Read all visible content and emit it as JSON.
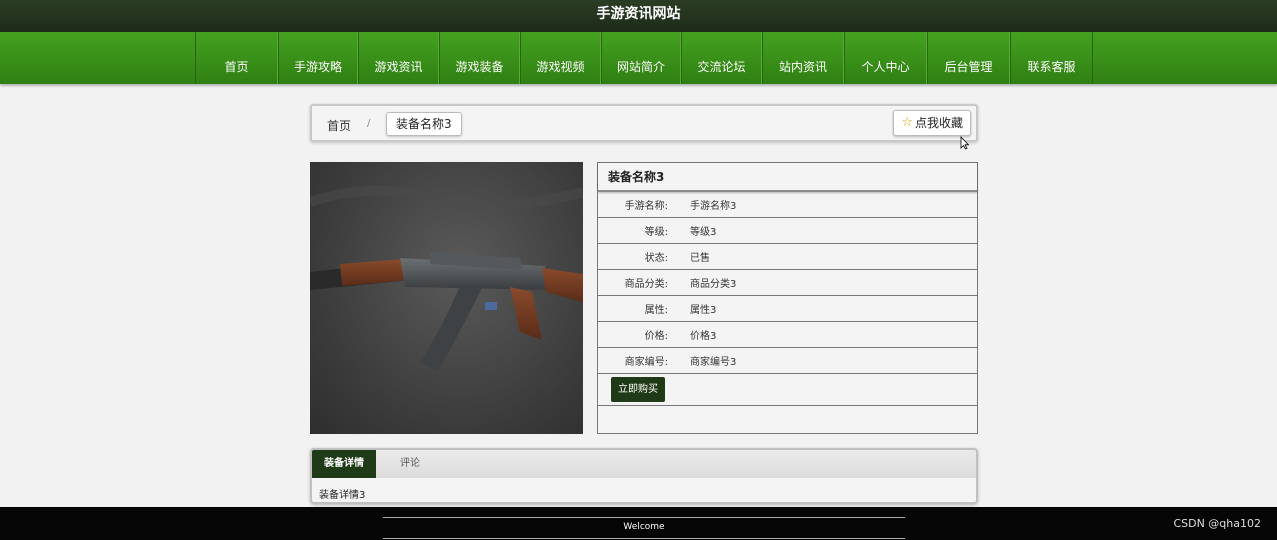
{
  "header": {
    "site_title": "手游资讯网站"
  },
  "nav": {
    "items": [
      "首页",
      "手游攻略",
      "游戏资讯",
      "游戏装备",
      "游戏视频",
      "网站简介",
      "交流论坛",
      "站内资讯",
      "个人中心",
      "后台管理",
      "联系客服"
    ]
  },
  "breadcrumb": {
    "home": "首页",
    "separator": "/",
    "current": "装备名称3"
  },
  "favorite": {
    "icon": "star-icon",
    "label": "点我收藏"
  },
  "product": {
    "title": "装备名称3",
    "fields": [
      {
        "label": "手游名称:",
        "value": "手游名称3"
      },
      {
        "label": "等级:",
        "value": "等级3"
      },
      {
        "label": "状态:",
        "value": "已售"
      },
      {
        "label": "商品分类:",
        "value": "商品分类3"
      },
      {
        "label": "属性:",
        "value": "属性3"
      },
      {
        "label": "价格:",
        "value": "价格3"
      },
      {
        "label": "商家编号:",
        "value": "商家编号3"
      }
    ],
    "buy_label": "立即购买"
  },
  "tabs": {
    "items": [
      {
        "label": "装备详情",
        "active": true
      },
      {
        "label": "评论",
        "active": false
      }
    ],
    "content": "装备详情3"
  },
  "footer": {
    "welcome": "Welcome",
    "watermark": "CSDN @qha102"
  },
  "colors": {
    "nav_green": "#3a9418",
    "dark_green": "#1f3a17",
    "footer": "#050505"
  }
}
